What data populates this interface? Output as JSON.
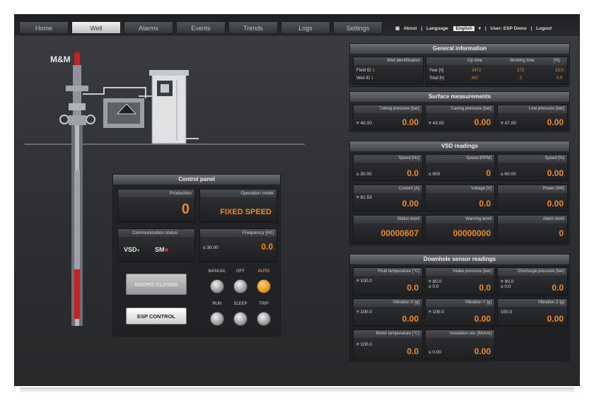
{
  "tabs": [
    {
      "label": "Home",
      "active": false
    },
    {
      "label": "Well",
      "active": true
    },
    {
      "label": "Alarms",
      "active": false
    },
    {
      "label": "Events",
      "active": false
    },
    {
      "label": "Trends",
      "active": false
    },
    {
      "label": "Logs",
      "active": false
    },
    {
      "label": "Settings",
      "active": false
    }
  ],
  "topbar": {
    "about": "About",
    "language_label": "Language",
    "language_value": "English",
    "user_label": "User: ESP Demo",
    "logout": "Logout"
  },
  "colors": {
    "accent": "#f08a2c",
    "value": "#f08a2c"
  },
  "logo_text": "M&M",
  "general_information": {
    "title": "General information",
    "well_identification": "Well identification",
    "col_op_time": "Op time",
    "col_working_time": "Working time",
    "col_pct": "[%]",
    "row1_label": "Field ID",
    "row1_value": "1",
    "row2_label": "Well ID",
    "row2_value": "1",
    "year_h_label": "Year [h]",
    "year_h_op": "2472",
    "year_h_work": "373",
    "year_h_pct": "15.0",
    "total_h_label": "Total [h]",
    "total_h_op": "857",
    "total_h_work": "0",
    "total_h_pct": "0.0"
  },
  "surface_measurements": {
    "title": "Surface measurements",
    "cells": [
      {
        "label": "Tubing pressure [bar]",
        "setpoint": "≡ 45.00",
        "value": "0.00"
      },
      {
        "label": "Casing pressure [bar]",
        "setpoint": "≡ 43.00",
        "value": "0.00"
      },
      {
        "label": "Line pressure [bar]",
        "setpoint": "≡ 47.00",
        "value": "0.00"
      }
    ]
  },
  "vsd_readings": {
    "title": "VSD readings",
    "row1": [
      {
        "label": "Speed [Hz]",
        "setpoint": "≤ 30.00",
        "value": "0.0"
      },
      {
        "label": "Speed [RPM]",
        "setpoint": "≤ 900",
        "value": "0"
      },
      {
        "label": "Speed [%]",
        "setpoint": "≤ 60.00",
        "value": "0.00"
      }
    ],
    "row2": [
      {
        "label": "Current [A]",
        "setpoint": "≡ 81.53",
        "value": "0.00"
      },
      {
        "label": "Voltage [V]",
        "setpoint": "",
        "value": "0.0"
      },
      {
        "label": "Power [kW]",
        "setpoint": "",
        "value": "0.00"
      }
    ],
    "row3": [
      {
        "label": "Status word",
        "value": "00000607"
      },
      {
        "label": "Warning word",
        "value": "00000000"
      },
      {
        "label": "Alarm word",
        "value": "0"
      }
    ]
  },
  "downhole": {
    "title": "Downhole sensor readings",
    "row1": [
      {
        "label": "Fluid temperature [°C]",
        "setpoint": "≡ 100.0",
        "value": "0.0"
      },
      {
        "label": "Intake pressure [bar]",
        "setpoint": "≡ 80.0\n≤ 0.0",
        "value": "0.0"
      },
      {
        "label": "Discharge pressure [bar]",
        "setpoint": "≡ 90.0\n≤ 0.0",
        "value": "0.0"
      }
    ],
    "row2": [
      {
        "label": "Vibration X [g]",
        "setpoint": "≡ 100.0",
        "value": "0.00"
      },
      {
        "label": "Vibration Y [g]",
        "setpoint": "≡ 100.0",
        "value": "0.00"
      },
      {
        "label": "Vibration Z [g]",
        "setpoint": "100.0",
        "value": "0.00"
      }
    ],
    "row3": [
      {
        "label": "Motor temperature [°C]",
        "setpoint": "≡ 100.0",
        "value": "0.0"
      },
      {
        "label": "Insulation res. [Mohm]",
        "setpoint": "≤ 0.00",
        "value": "0.00"
      }
    ]
  },
  "control_panel": {
    "title": "Control panel",
    "production_label": "Production",
    "production_value": "0",
    "operation_mode_label": "Operation mode",
    "operation_mode_value": "FIXED SPEED",
    "communication_label": "Communication status",
    "comm_vsd": "VSD",
    "comm_sm": "SM",
    "frequency_label": "Frequency [Hz]",
    "frequency_setpoint": "≤ 30.00",
    "frequency_value": "0.0",
    "doors_button": "DOORS CLOSED",
    "esp_button": "ESP CONTROL",
    "indicators_top": [
      {
        "label": "MANUAL",
        "on": false
      },
      {
        "label": "OFF",
        "on": false
      },
      {
        "label": "AUTO",
        "on": true
      }
    ],
    "indicators_bottom": [
      {
        "label": "RUN",
        "on": false
      },
      {
        "label": "SLEEP",
        "on": false
      },
      {
        "label": "TRIP",
        "on": false
      }
    ]
  }
}
